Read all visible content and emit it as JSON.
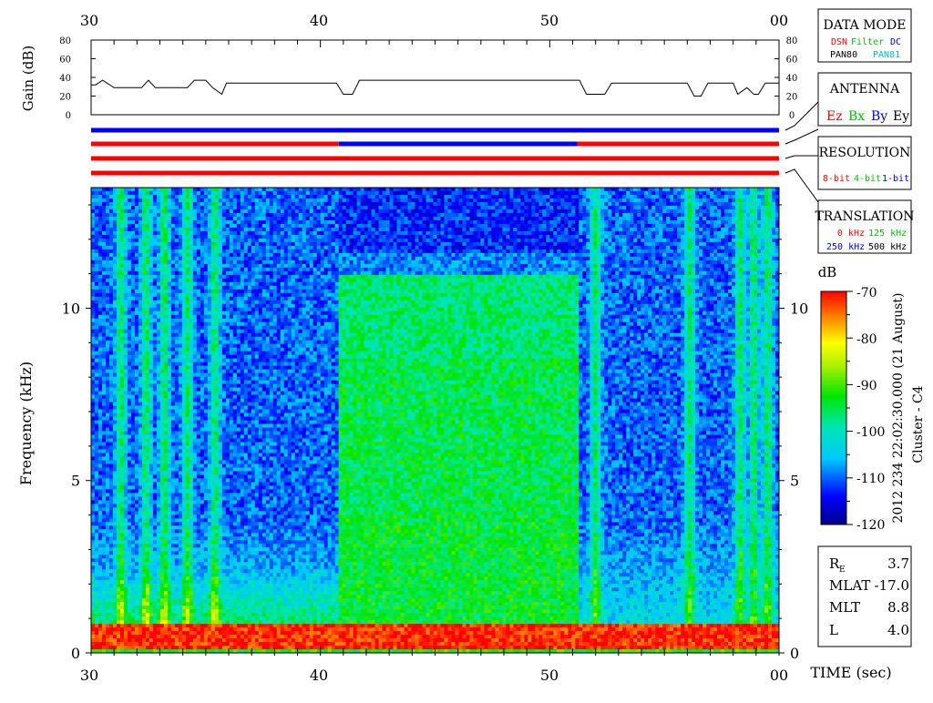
{
  "chart_data": {
    "type": "heatmap",
    "title": "",
    "time_axis": {
      "tick_labels": [
        "30",
        "40",
        "50",
        "00"
      ],
      "xlim": [
        30,
        60
      ],
      "xlabel": "TIME (sec)"
    },
    "gain_panel": {
      "ylabel": "Gain (dB)",
      "ylim": [
        0,
        80
      ],
      "y_ticks": [
        0,
        20,
        40,
        60,
        80
      ],
      "gain_trace": {
        "t": [
          30.0,
          30.2,
          30.5,
          31.0,
          32.2,
          32.5,
          32.8,
          34.2,
          34.5,
          35.0,
          35.3,
          35.7,
          35.9,
          40.7,
          41.0,
          41.4,
          41.7,
          51.3,
          51.6,
          52.4,
          52.7,
          56.0,
          56.3,
          56.6,
          56.9,
          58.0,
          58.2,
          58.6,
          58.9,
          59.1,
          59.4,
          59.8,
          60.0
        ],
        "gain": [
          32,
          32,
          37,
          29,
          29,
          37,
          29,
          29,
          37,
          37,
          29,
          22,
          34,
          34,
          22,
          22,
          37,
          37,
          22,
          22,
          34,
          34,
          20,
          20,
          34,
          34,
          22,
          29,
          22,
          22,
          34,
          34,
          34
        ]
      }
    },
    "mode_bars": [
      {
        "name": "data-mode",
        "segments": [
          {
            "t0": 30,
            "t1": 60,
            "color": "#0000ff"
          }
        ]
      },
      {
        "name": "antenna",
        "segments": [
          {
            "t0": 30,
            "t1": 40.8,
            "color": "#ff0000"
          },
          {
            "t0": 40.8,
            "t1": 51.2,
            "color": "#0000ff"
          },
          {
            "t0": 51.2,
            "t1": 60,
            "color": "#ff0000"
          }
        ]
      },
      {
        "name": "resolution",
        "segments": [
          {
            "t0": 30,
            "t1": 60,
            "color": "#ff0000"
          }
        ]
      },
      {
        "name": "translation",
        "segments": [
          {
            "t0": 30,
            "t1": 60,
            "color": "#ff0000"
          }
        ]
      }
    ],
    "spectrogram": {
      "ylabel": "Frequency (kHz)",
      "ylim": [
        0,
        13.5
      ],
      "y_ticks": [
        0,
        5,
        10
      ],
      "clim": [
        -120,
        -70
      ],
      "colorbar_label": "dB",
      "colorbar_ticks": [
        "-70",
        "-80",
        "-90",
        "-100",
        "-110",
        "-120"
      ],
      "regions": [
        {
          "t0": 30,
          "t1": 40.8,
          "note": "low-level band with bright low-frequency emission"
        },
        {
          "t0": 40.8,
          "t1": 51.2,
          "note": "elevated level up to about 11 kHz"
        },
        {
          "t0": 51.2,
          "t1": 60,
          "note": "low-level band with vertical stripes"
        }
      ],
      "stripes": [
        31.3,
        32.4,
        33.2,
        34.2,
        35.4,
        41.2,
        52.0,
        56.1,
        58.3,
        58.9,
        59.5
      ]
    }
  },
  "legend_boxes": {
    "data_mode": {
      "title": "DATA MODE",
      "items": [
        {
          "label": "DSN",
          "color": "#ff0000"
        },
        {
          "label": "Filter",
          "color": "#00c000"
        },
        {
          "label": "DC",
          "color": "#0000ff"
        },
        {
          "label": "PAN80",
          "color": "#000000"
        },
        {
          "label": "PAN81",
          "color": "#00c0c0"
        }
      ]
    },
    "antenna": {
      "title": "ANTENNA",
      "items": [
        {
          "label": "Ez",
          "color": "#ff0000"
        },
        {
          "label": "Bx",
          "color": "#00c000"
        },
        {
          "label": "By",
          "color": "#0000ff"
        },
        {
          "label": "Ey",
          "color": "#000000"
        }
      ]
    },
    "resolution": {
      "title": "RESOLUTION",
      "items": [
        {
          "label": "8-bit",
          "color": "#ff0000"
        },
        {
          "label": "4-bit",
          "color": "#00c000"
        },
        {
          "label": "1-bit",
          "color": "#0000ff"
        }
      ]
    },
    "translation": {
      "title": "TRANSLATION",
      "items": [
        {
          "label": "0 kHz",
          "color": "#ff0000"
        },
        {
          "label": "125 kHz",
          "color": "#00c000"
        },
        {
          "label": "250 kHz",
          "color": "#0000ff"
        },
        {
          "label": "500 kHz",
          "color": "#000000"
        }
      ]
    }
  },
  "side_label": "2012 234 22:02:30.000 (21 August)",
  "side_label2": "Cluster - C4",
  "orbit_info": [
    {
      "label": "R",
      "sub": "E",
      "value": "3.7"
    },
    {
      "label": "MLAT",
      "sub": "",
      "value": "-17.0"
    },
    {
      "label": "MLT",
      "sub": "",
      "value": "8.8"
    },
    {
      "label": "L",
      "sub": "",
      "value": "4.0"
    }
  ]
}
